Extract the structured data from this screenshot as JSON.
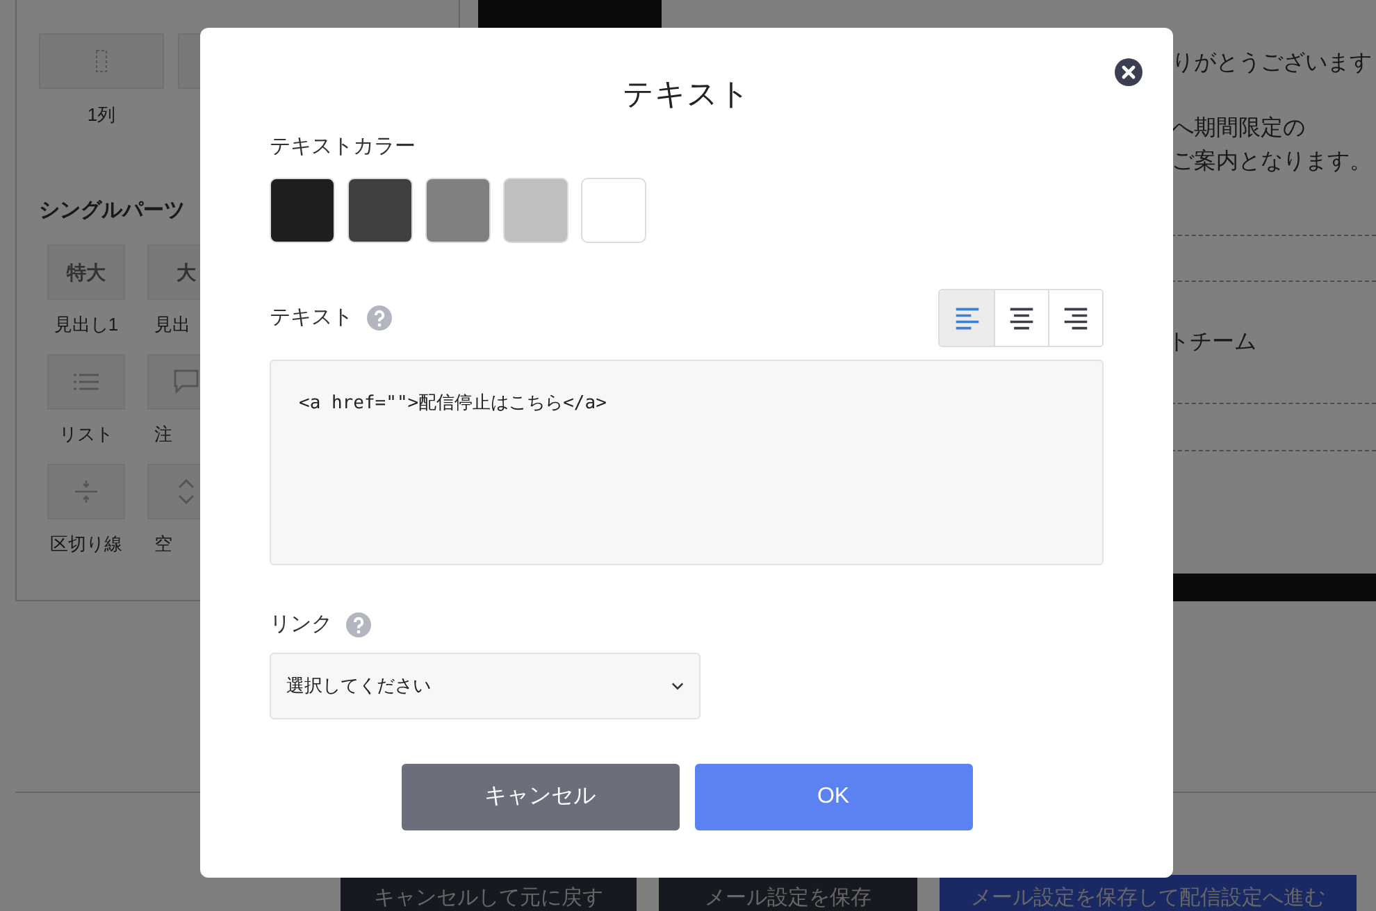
{
  "sidebar": {
    "layout_tiles": [
      {
        "label": "1列",
        "kind": "column"
      },
      {
        "kind": "blank"
      }
    ],
    "section_title": "シングルパーツ",
    "parts": [
      {
        "label": "見出し1",
        "kind": "text",
        "glyph": "特大"
      },
      {
        "label": "見出",
        "kind": "text",
        "glyph": "大"
      },
      {
        "label": "リスト",
        "kind": "list"
      },
      {
        "label": "注",
        "kind": "comment"
      },
      {
        "label": "区切り線",
        "kind": "divider"
      },
      {
        "label": "空",
        "kind": "spacer"
      }
    ]
  },
  "preview": {
    "lines": [
      "りがとうございます",
      "へ期間限定の",
      "ご案内となります。"
    ],
    "team_line": "トチーム"
  },
  "footer_buttons": [
    {
      "label": "キャンセルして元に戻す",
      "kind": "dark"
    },
    {
      "label": "メール設定を保存",
      "kind": "dark"
    },
    {
      "label": "メール設定を保存して配信設定へ進む",
      "kind": "primary"
    }
  ],
  "dialog": {
    "title": "テキスト",
    "color_label": "テキストカラー",
    "colors": [
      {
        "color": "#1e1e1e",
        "selected": false
      },
      {
        "color": "#404040",
        "selected": false
      },
      {
        "color": "#808080",
        "selected": false
      },
      {
        "color": "#bfbfbf",
        "selected": false
      },
      {
        "color": "#ffffff",
        "selected": false
      }
    ],
    "text_label": "テキスト",
    "align": [
      {
        "kind": "left",
        "selected": true
      },
      {
        "kind": "center",
        "selected": false
      },
      {
        "kind": "right",
        "selected": false
      }
    ],
    "text_value": "<a href=\"\">配信停止はこちら</a>",
    "link_label": "リンク",
    "link_select": "選択してください",
    "buttons": [
      {
        "label": "キャンセル",
        "kind": "cancel"
      },
      {
        "label": "OK",
        "kind": "ok"
      }
    ]
  }
}
